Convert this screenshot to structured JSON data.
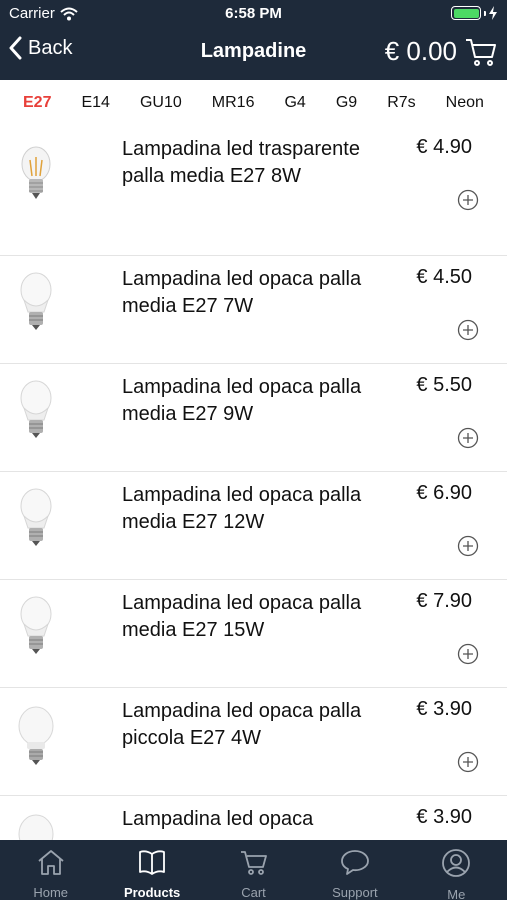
{
  "status_bar": {
    "carrier": "Carrier",
    "time": "6:58 PM"
  },
  "nav": {
    "back_label": "Back",
    "title": "Lampadine",
    "cart_total": "€ 0.00"
  },
  "tabs": [
    "E27",
    "E14",
    "GU10",
    "MR16",
    "G4",
    "G9",
    "R7s",
    "Neon"
  ],
  "active_tab": "E27",
  "products": [
    {
      "name": "Lampadina led trasparente palla media E27 8W",
      "price": "€ 4.90",
      "image": "filament-bulb"
    },
    {
      "name": "Lampadina led opaca palla media E27 7W",
      "price": "€ 4.50",
      "image": "opaque-bulb"
    },
    {
      "name": "Lampadina led opaca palla media E27 9W",
      "price": "€ 5.50",
      "image": "opaque-bulb"
    },
    {
      "name": "Lampadina led opaca palla media E27 12W",
      "price": "€ 6.90",
      "image": "opaque-bulb"
    },
    {
      "name": "Lampadina led opaca palla media E27 15W",
      "price": "€ 7.90",
      "image": "opaque-bulb"
    },
    {
      "name": "Lampadina led opaca palla piccola E27 4W",
      "price": "€ 3.90",
      "image": "small-opaque-bulb"
    },
    {
      "name": "Lampadina led opaca",
      "price": "€ 3.90",
      "image": "small-opaque-bulb"
    }
  ],
  "bottom_tabs": [
    {
      "label": "Home",
      "icon": "home-icon"
    },
    {
      "label": "Products",
      "icon": "book-icon"
    },
    {
      "label": "Cart",
      "icon": "cart-icon"
    },
    {
      "label": "Support",
      "icon": "chat-bubble-icon"
    },
    {
      "label": "Me",
      "icon": "user-icon"
    }
  ],
  "active_bottom_tab": "Products",
  "colors": {
    "bar_background": "#1e2a3a",
    "accent": "#e8403a",
    "battery": "#4cd964"
  }
}
